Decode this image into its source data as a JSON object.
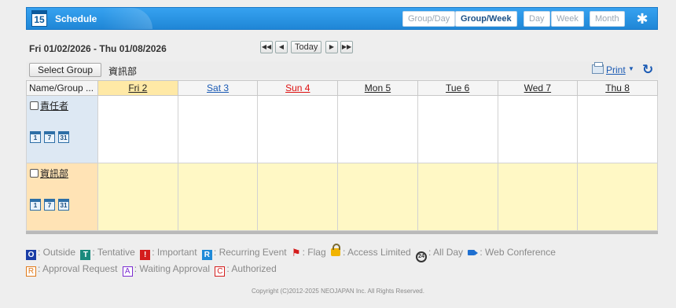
{
  "app": {
    "title": "Schedule",
    "icon_day": "15",
    "view_buttons": [
      "Group/Day",
      "Group/Week",
      "Day",
      "Week",
      "Month"
    ],
    "active_view": "Group/Week"
  },
  "nav": {
    "date_range": "Fri 01/02/2026 - Thu 01/08/2026",
    "first": "◀◀",
    "prev": "◀",
    "today": "Today",
    "next": "▶",
    "last": "▶▶"
  },
  "toolbar": {
    "select_group_label": "Select Group",
    "group_name": "資訊部",
    "print_label": "Print",
    "refresh_icon": "↻"
  },
  "grid": {
    "name_header": "Name/Group ...",
    "days": [
      "Fri 2",
      "Sat 3",
      "Sun 4",
      "Mon 5",
      "Tue 6",
      "Wed 7",
      "Thu 8"
    ],
    "rows": [
      {
        "name": "責任者",
        "type": "user"
      },
      {
        "name": "資訊部",
        "type": "group"
      }
    ],
    "mini_icons": [
      "1",
      "7",
      "31"
    ]
  },
  "legend": {
    "outside": {
      "glyph": "O",
      "label": ": Outside"
    },
    "tentative": {
      "glyph": "T",
      "label": ": Tentative"
    },
    "important": {
      "glyph": "!",
      "label": ": Important"
    },
    "recurring": {
      "glyph": "R",
      "label": ": Recurring Event"
    },
    "flag": {
      "label": ": Flag"
    },
    "access": {
      "label": ": Access Limited"
    },
    "allday": {
      "glyph": "24",
      "label": ": All Day"
    },
    "webconf": {
      "label": ": Web Conference"
    },
    "approval_request": {
      "glyph": "R",
      "label": ": Approval Request"
    },
    "waiting_approval": {
      "glyph": "A",
      "label": ": Waiting Approval"
    },
    "authorized": {
      "glyph": "C",
      "label": ": Authorized"
    }
  },
  "footer": {
    "copyright": "Copyright (C)2012-2025 NEOJAPAN Inc. All Rights Reserved."
  },
  "colors": {
    "header_blue": "#1f86d6",
    "today_column": "#ffe9a6",
    "user_row": "#dde8f3",
    "group_row": "#fff8c5",
    "group_name_cell": "#ffe3b5"
  }
}
